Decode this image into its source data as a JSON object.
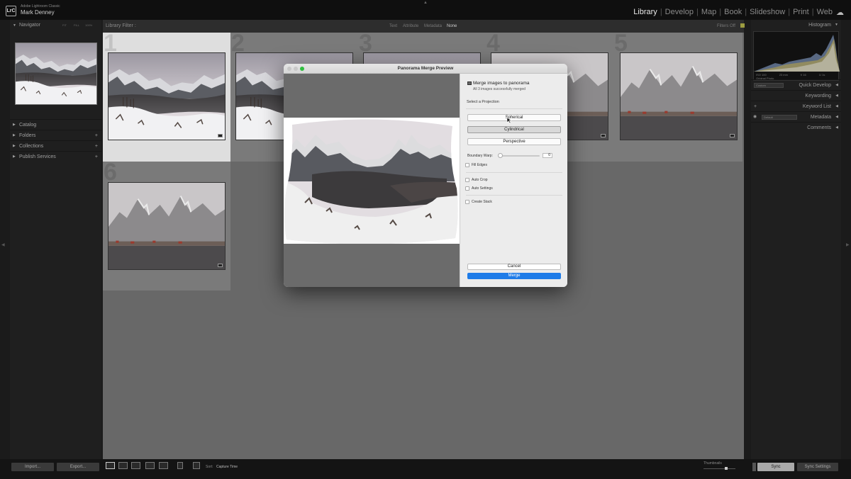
{
  "app": {
    "product": "Adobe Lightroom Classic",
    "user": "Mark Denney",
    "logo": "LrC",
    "modules": [
      "Library",
      "Develop",
      "Map",
      "Book",
      "Slideshow",
      "Print",
      "Web"
    ],
    "active_module": "Library",
    "icons": {
      "cloud": "cloud-icon"
    }
  },
  "left_panel": {
    "navigator_title": "Navigator",
    "zoom_levels": [
      "FIT",
      "FILL",
      "100%",
      "FILL"
    ],
    "items": [
      {
        "label": "Catalog",
        "plus": ""
      },
      {
        "label": "Folders",
        "plus": "+"
      },
      {
        "label": "Collections",
        "plus": "+"
      },
      {
        "label": "Publish Services",
        "plus": "+"
      }
    ]
  },
  "filter_bar": {
    "title": "Library Filter :",
    "options": [
      "Text",
      "Attribute",
      "Metadata",
      "None"
    ],
    "active": "None",
    "filters_off": "Filters Off"
  },
  "grid": {
    "cells": [
      {
        "num": "1",
        "selected": true
      },
      {
        "num": "2",
        "selected": false
      },
      {
        "num": "3",
        "selected": false
      },
      {
        "num": "4",
        "selected": false
      },
      {
        "num": "5",
        "selected": false
      },
      {
        "num": "6",
        "selected": false
      }
    ]
  },
  "right_panel": {
    "histogram_title": "Histogram",
    "histogram_info": [
      "ISO 100",
      "23 mm",
      "f/ 16",
      "1/ 1s"
    ],
    "original_photo": "Original Photo",
    "custom_label": "Custom",
    "sections": [
      "Quick Develop",
      "Keywording",
      "Keyword List",
      "Metadata",
      "Comments"
    ],
    "metadata_preset": "Default"
  },
  "dialog": {
    "title": "Panorama Merge Preview",
    "header": "Merge images to panorama",
    "status": "All 3 images successfully merged",
    "select_label": "Select a Projection",
    "projections": [
      "Spherical",
      "Cylindrical",
      "Perspective"
    ],
    "selected_projection": "Cylindrical",
    "boundary_warp_label": "Boundary Warp:",
    "boundary_warp_value": "0",
    "boundary_warp_fraction": 0,
    "fill_edges": "Fill Edges",
    "auto_crop": "Auto Crop",
    "auto_settings": "Auto Settings",
    "create_stack": "Create Stack",
    "cancel": "Cancel",
    "merge": "Merge",
    "colors": {
      "merge": "#1f7ce8"
    }
  },
  "bottom_bar": {
    "import": "Import...",
    "export": "Export...",
    "sort_label": "Sort:",
    "sort_value": "Capture Time",
    "thumbnails_label": "Thumbnails",
    "sync": "Sync",
    "sync_settings": "Sync Settings"
  }
}
